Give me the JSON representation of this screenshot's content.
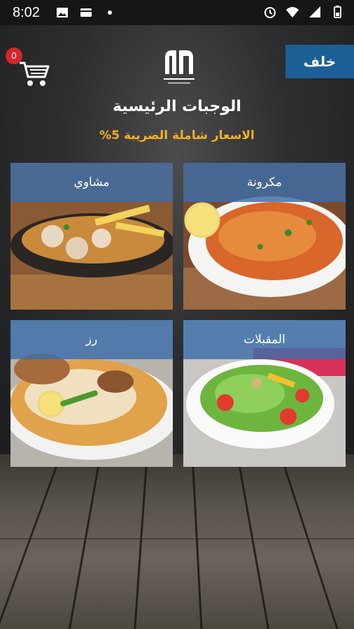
{
  "status_bar": {
    "time": "8:02",
    "left_icons": [
      "image-icon",
      "card-icon",
      "dot-icon"
    ],
    "right_icons": [
      "alarm-icon",
      "wifi-icon",
      "signal-icon",
      "battery-icon"
    ]
  },
  "header": {
    "back_label": "خلف",
    "cart_count": "0",
    "title": "الوجبات الرئيسية",
    "tax_note": "الاسعار شاملة الضريبة 5%"
  },
  "categories": [
    {
      "id": "pasta",
      "label": "مكرونة"
    },
    {
      "id": "grills",
      "label": "مشاوي"
    },
    {
      "id": "appetizers",
      "label": "المقبلات"
    },
    {
      "id": "rice",
      "label": "رز"
    }
  ],
  "colors": {
    "accent": "#1c5f97",
    "tax_text": "#f5b21d",
    "badge": "#d3252d",
    "label_bar": "#3c6eaa"
  }
}
